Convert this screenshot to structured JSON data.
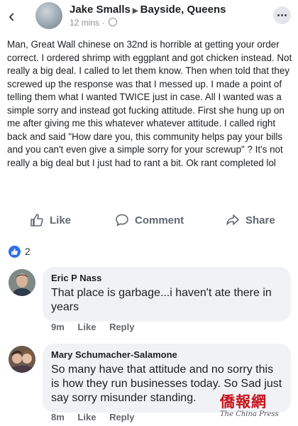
{
  "header": {
    "author": "Jake Smalls",
    "group": "Bayside, Queens",
    "time": "12 mins",
    "separator": "·"
  },
  "post": {
    "text": "Man, Great Wall chinese on 32nd is horrible at getting your order correct. I ordered shrimp with eggplant and got chicken instead. Not really a big deal. I called to let them know. Then when told that they screwed up the response was that I messed up. I made a point of telling them what I wanted TWICE just in case. All I wanted was a simple sorry and instead got fucking attitude. First she hung up on me after giving me this whatever whatever attitude. I called right back and said \"How dare you, this community helps pay your bills and you can't even give a simple sorry for your screwup\" ? It's not really a big deal but I just had to rant a bit. Ok rant completed lol"
  },
  "actions": {
    "like": "Like",
    "comment": "Comment",
    "share": "Share"
  },
  "reactions": {
    "count": "2"
  },
  "comments": [
    {
      "name": "Eric P Nass",
      "text": "That place is garbage...i haven't ate there in years",
      "time": "9m",
      "like": "Like",
      "reply": "Reply"
    },
    {
      "name": "Mary Schumacher-Salamone",
      "text": "So many have that attitude and no sorry this is how they run businesses today. So Sad just say sorry misunder standing.",
      "time": "8m",
      "like": "Like",
      "reply": "Reply"
    }
  ],
  "watermark": {
    "cn": "僑報網",
    "en": "The China Press"
  },
  "colors": {
    "like_blue": "#2e6fe8",
    "bubble_bg": "#f0f2f5",
    "meta_gray": "#65676b"
  }
}
